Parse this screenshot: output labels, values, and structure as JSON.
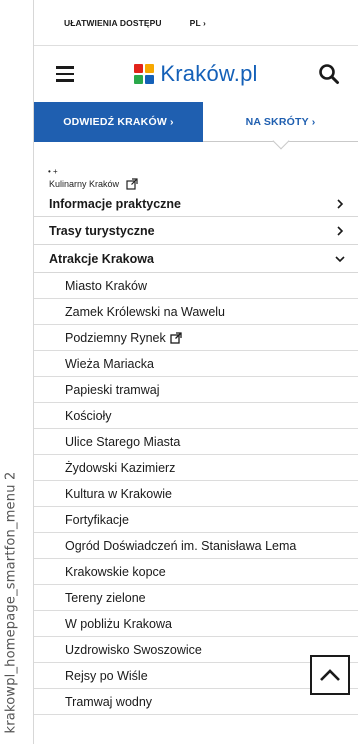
{
  "side_caption": "krakowpl_homepage_smartfon_menu 2",
  "topbar": {
    "accessibility": "UŁATWIENIA DOSTĘPU",
    "language": "PL ›"
  },
  "header": {
    "logo_text": "Kraków.pl",
    "logo_colors": [
      "#e2231a",
      "#f7a800",
      "#2aa84a",
      "#1460b8"
    ]
  },
  "tabs": {
    "visit": "ODWIEDŹ KRAKÓW ›",
    "shortcuts": "NA SKRÓTY ›"
  },
  "bullets": "• +",
  "kulinarny": "Kulinarny Kraków",
  "menu": [
    {
      "label": "Informacje praktyczne",
      "icon": "chevron-right-icon"
    },
    {
      "label": "Trasy turystyczne",
      "icon": "chevron-right-icon"
    },
    {
      "label": "Atrakcje Krakowa",
      "icon": "chevron-down-icon"
    }
  ],
  "submenu": [
    "Miasto Kraków",
    "Zamek Królewski na Wawelu",
    "Podziemny Rynek",
    "Wieża Mariacka",
    "Papieski tramwaj",
    "Kościoły",
    "Ulice Starego Miasta",
    "Żydowski Kazimierz",
    "Kultura w Krakowie",
    "Fortyfikacje",
    "Ogród Doświadczeń im. Stanisława Lema",
    "Krakowskie kopce",
    "Tereny zielone",
    "W pobliżu Krakowa",
    "Uzdrowisko Swoszowice",
    "Rejsy po Wiśle",
    "Tramwaj wodny"
  ],
  "colors": {
    "brand_blue": "#1f5fb0",
    "logo_blue": "#1460b8"
  }
}
